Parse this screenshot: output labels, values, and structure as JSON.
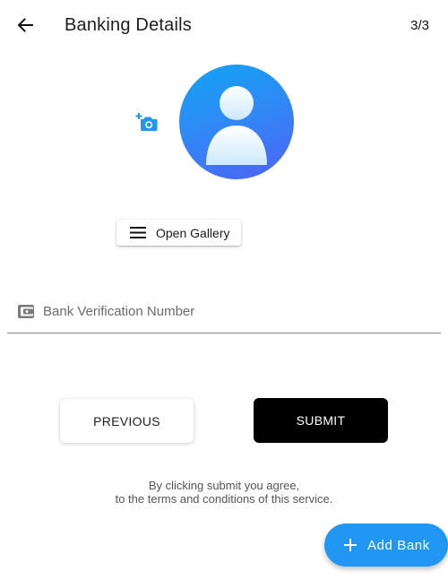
{
  "app_bar": {
    "back_icon": "arrow-back-icon",
    "title": "Banking Details",
    "step": "3/3"
  },
  "photo": {
    "camera_icon": "add-a-photo-icon",
    "avatar_icon": "person-icon",
    "avatar_gradient": [
      "#0fa5f4",
      "#4f62f4"
    ],
    "gallery_icon": "menu-icon",
    "gallery_label": "Open Gallery"
  },
  "bvn_field": {
    "icon": "wallet-icon",
    "placeholder": "Bank Verification Number",
    "value": ""
  },
  "actions": {
    "previous_label": "PREVIOUS",
    "submit_label": "SUBMIT"
  },
  "terms": {
    "line1": "By clicking submit you agree,",
    "line2": "to the terms and conditions of this service."
  },
  "fab": {
    "icon": "plus-icon",
    "label": "Add Bank",
    "color": "#2196f3"
  }
}
